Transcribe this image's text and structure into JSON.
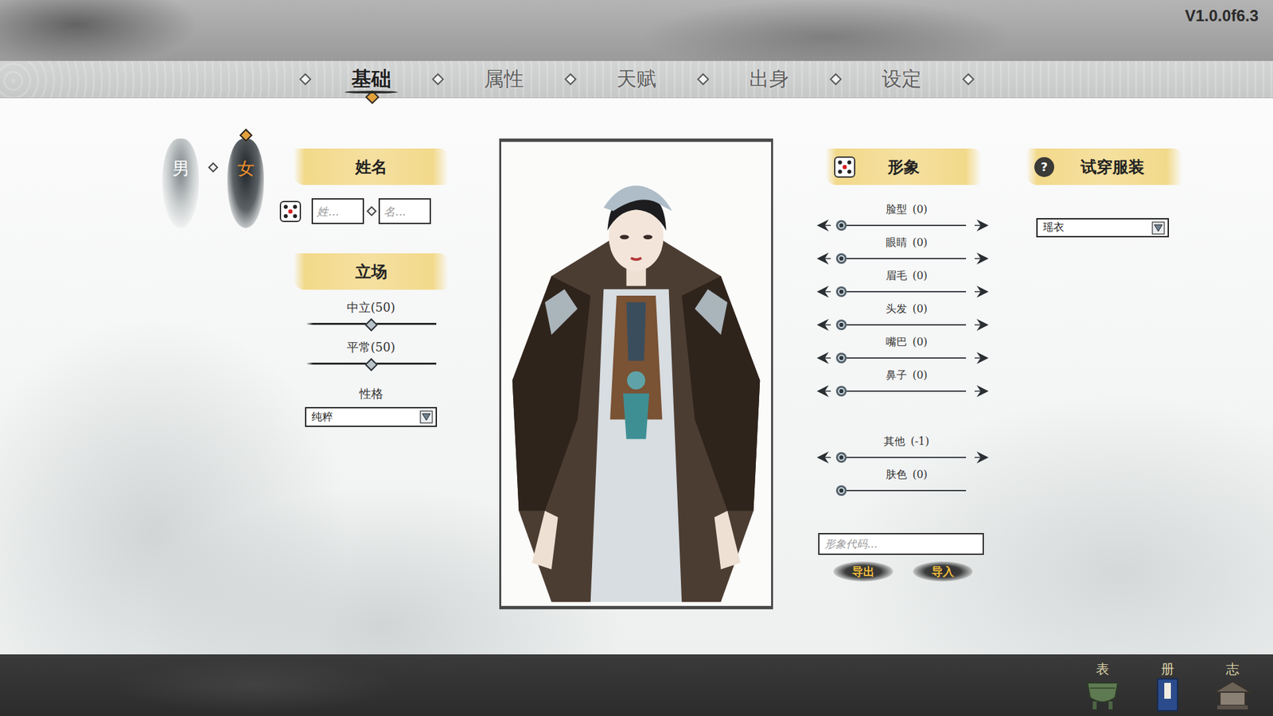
{
  "version": "V1.0.0f6.3",
  "tabs": [
    {
      "label": "基础",
      "selected": true
    },
    {
      "label": "属性",
      "selected": false
    },
    {
      "label": "天赋",
      "selected": false
    },
    {
      "label": "出身",
      "selected": false
    },
    {
      "label": "设定",
      "selected": false
    }
  ],
  "gender": [
    {
      "label": "男",
      "selected": false
    },
    {
      "label": "女",
      "selected": true
    }
  ],
  "name": {
    "title": "姓名",
    "surname_placeholder": "姓...",
    "given_placeholder": "名..."
  },
  "stance": {
    "title": "立场",
    "sliders": [
      {
        "label": "中立(50)",
        "level": 0.5
      },
      {
        "label": "平常(50)",
        "level": 0.5
      }
    ],
    "personality": {
      "label": "性格",
      "value": "纯粹"
    }
  },
  "appearance": {
    "title": "形象",
    "sliders": [
      {
        "label": "脸型",
        "reading": "(0)",
        "level": 0,
        "arrows": true
      },
      {
        "label": "眼睛",
        "reading": "(0)",
        "level": 0,
        "arrows": true
      },
      {
        "label": "眉毛",
        "reading": "(0)",
        "level": 0,
        "arrows": true
      },
      {
        "label": "头发",
        "reading": "(0)",
        "level": 0,
        "arrows": true
      },
      {
        "label": "嘴巴",
        "reading": "(0)",
        "level": 0,
        "arrows": true
      },
      {
        "label": "鼻子",
        "reading": "(0)",
        "level": 0,
        "arrows": true
      }
    ],
    "extra_sliders": [
      {
        "label": "其他",
        "reading": "(-1)",
        "level": 0,
        "arrows": true
      },
      {
        "label": "肤色",
        "reading": "(0)",
        "level": 0,
        "arrows": false
      }
    ],
    "code_placeholder": "形象代码...",
    "buttons": [
      "导出",
      "导入"
    ]
  },
  "outfit": {
    "title": "试穿服装",
    "help": "?",
    "value": "瑶衣"
  },
  "dock": [
    {
      "label": "表"
    },
    {
      "label": "册"
    },
    {
      "label": "志"
    }
  ]
}
